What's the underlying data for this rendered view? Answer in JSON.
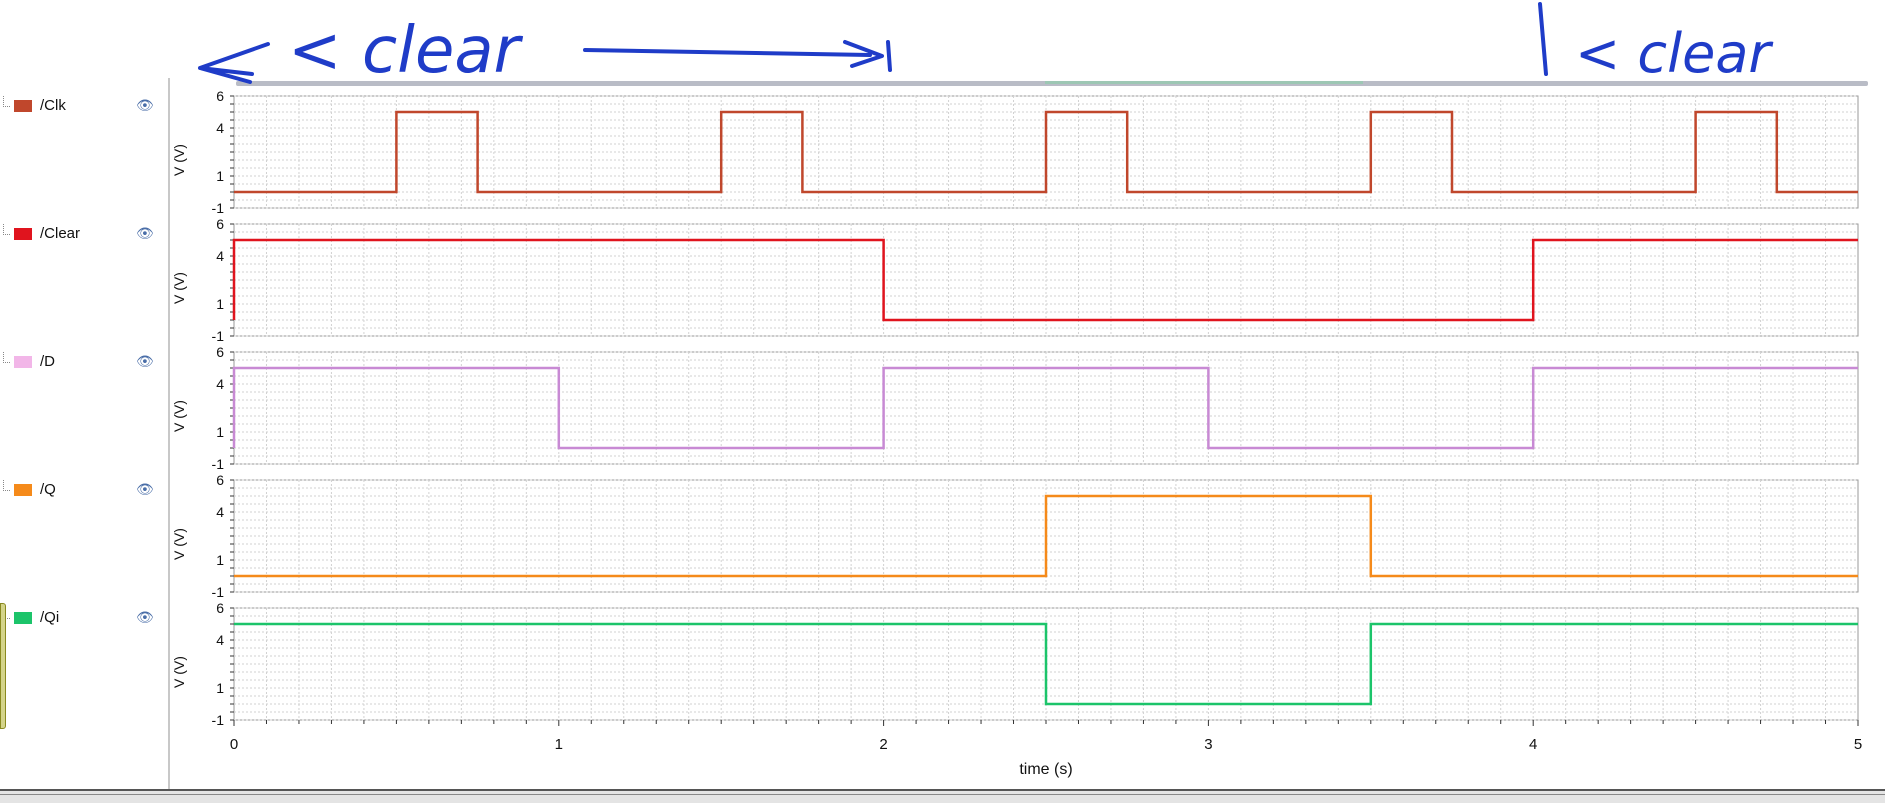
{
  "signals": [
    {
      "name": "/Clk",
      "color": "#c0472c",
      "icon": "eye-icon"
    },
    {
      "name": "/Clear",
      "color": "#e0141e",
      "icon": "eye-icon"
    },
    {
      "name": "/D",
      "color": "#f2b6e8",
      "line_color": "#c88ad4",
      "icon": "eye-icon"
    },
    {
      "name": "/Q",
      "color": "#f58a1a",
      "icon": "eye-icon"
    },
    {
      "name": "/Qi",
      "color": "#1cc46a",
      "icon": "eye-icon"
    }
  ],
  "annotations": {
    "left_text": "clear",
    "right_text": "clear",
    "color": "#1f3cc8"
  },
  "chart_data": {
    "type": "line",
    "xlabel": "time (s)",
    "ylabel": "V (V)",
    "xlim": [
      0,
      5
    ],
    "ylim": [
      -1,
      6
    ],
    "xticks": [
      0,
      1,
      2,
      3,
      4,
      5
    ],
    "xtick_labels": [
      "0",
      "1",
      "2",
      "3",
      "4",
      "5"
    ],
    "yticks": [
      -1,
      1,
      4,
      6
    ],
    "ytick_labels": [
      "-1",
      "1",
      "4",
      "6"
    ],
    "grid": true,
    "series": [
      {
        "name": "/Clk",
        "color": "#c0472c",
        "x": [
          0,
          0.5,
          0.5,
          0.75,
          0.75,
          1.5,
          1.5,
          1.75,
          1.75,
          2.5,
          2.5,
          2.75,
          2.75,
          3.5,
          3.5,
          3.75,
          3.75,
          4.5,
          4.5,
          4.75,
          4.75,
          5
        ],
        "y": [
          0,
          0,
          5,
          5,
          0,
          0,
          5,
          5,
          0,
          0,
          5,
          5,
          0,
          0,
          5,
          5,
          0,
          0,
          5,
          5,
          0,
          0
        ]
      },
      {
        "name": "/Clear",
        "color": "#e0141e",
        "x": [
          0,
          0,
          2,
          2,
          4,
          4,
          5
        ],
        "y": [
          0,
          5,
          5,
          0,
          0,
          5,
          5
        ]
      },
      {
        "name": "/D",
        "color": "#c88ad4",
        "x": [
          0,
          0,
          1,
          1,
          2,
          2,
          3,
          3,
          4,
          4,
          5
        ],
        "y": [
          0,
          5,
          5,
          0,
          0,
          5,
          5,
          0,
          0,
          5,
          5
        ]
      },
      {
        "name": "/Q",
        "color": "#f58a1a",
        "x": [
          0,
          2.5,
          2.5,
          3.5,
          3.5,
          5
        ],
        "y": [
          0,
          0,
          5,
          5,
          0,
          0
        ]
      },
      {
        "name": "/Qi",
        "color": "#1cc46a",
        "x": [
          0,
          2.5,
          2.5,
          3.5,
          3.5,
          5
        ],
        "y": [
          5,
          5,
          0,
          0,
          5,
          5
        ]
      }
    ]
  }
}
